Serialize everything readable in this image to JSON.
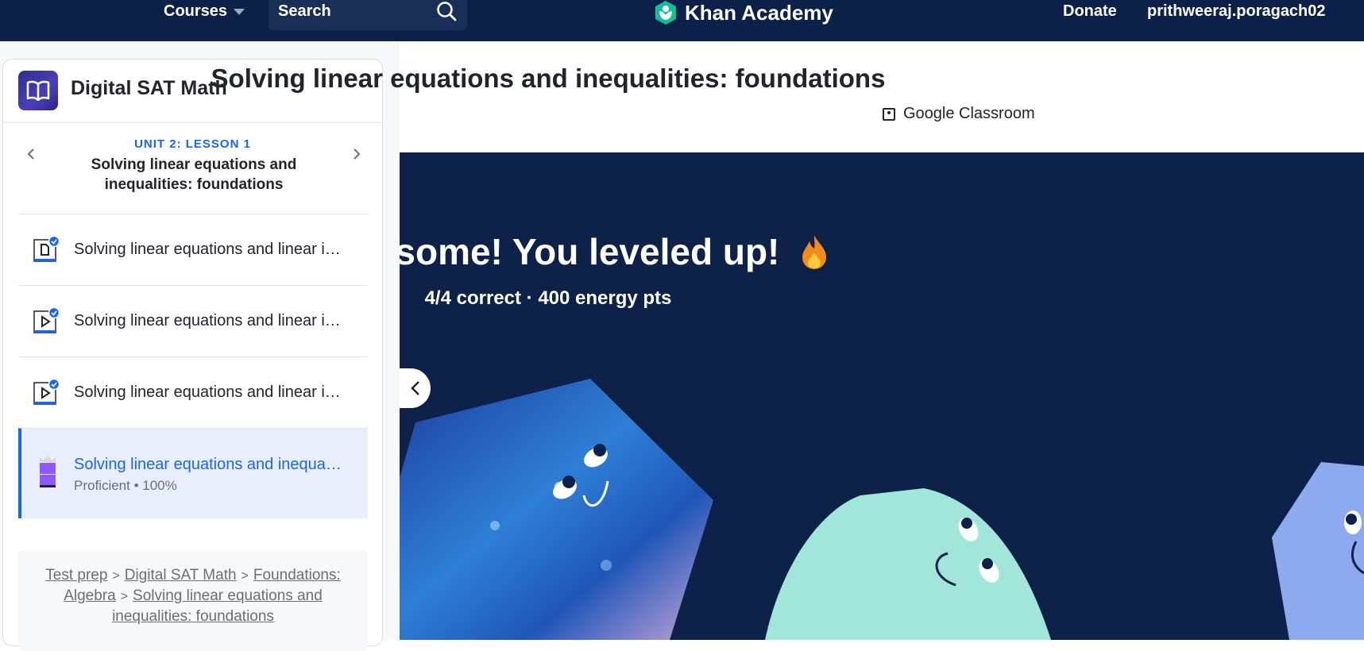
{
  "nav": {
    "courses_label": "Courses",
    "search_placeholder": "Search",
    "logo_text": "Khan Academy",
    "donate_label": "Donate",
    "username": "prithweeraj.poragach02"
  },
  "sidebar": {
    "course_title": "Digital SAT Math",
    "unit_label": "UNIT 2: LESSON 1",
    "lesson_title": "Solving linear equations and inequalities: foundations",
    "items": [
      {
        "label": "Solving linear equations and linear i…",
        "type": "article",
        "completed": true
      },
      {
        "label": "Solving linear equations and linear i…",
        "type": "video",
        "completed": true
      },
      {
        "label": "Solving linear equations and linear i…",
        "type": "video",
        "completed": true
      },
      {
        "label": "Solving linear equations and inequa…",
        "type": "exercise",
        "status": "Proficient • 100%",
        "active": true
      }
    ],
    "breadcrumb": [
      "Test prep",
      "Digital SAT Math",
      "Foundations: Algebra",
      "Solving linear equations and inequalities: foundations"
    ]
  },
  "main": {
    "title": "Solving linear equations and inequalities: foundations",
    "classroom_label": "Google Classroom",
    "hero_title": "Awesome! You leveled up!",
    "hero_subtitle": "4/4 correct · 400 energy pts"
  },
  "colors": {
    "nav_bg": "#0b2149",
    "hero_bg": "#0d2149",
    "accent": "#1865f2",
    "active_bg": "#e8eefc"
  }
}
